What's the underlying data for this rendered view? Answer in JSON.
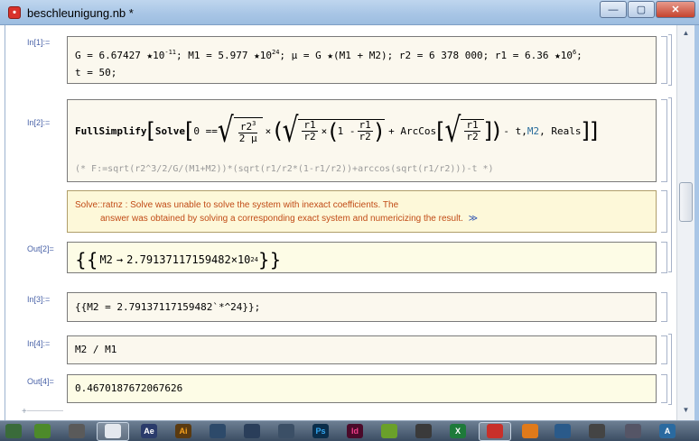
{
  "window": {
    "title": "beschleunigung.nb *",
    "min_glyph": "—",
    "max_glyph": "▢",
    "close_glyph": "✕"
  },
  "cells": {
    "in1_label": "In[1]:=",
    "in1_line1": {
      "a": "G = 6.67427 ",
      "b": "10",
      "c": "-11",
      "d": "; M1 = 5.977 ",
      "e": "10",
      "f": "24",
      "g": "; μ = G ",
      "h": "(M1 + M2); r2 = 6 378 000; r1 = 6.36 ",
      "i": "10",
      "j": "6",
      "k": ";"
    },
    "in1_line2": "t = 50;",
    "in2_label": "In[2]:=",
    "in2": {
      "fs": "FullSimplify",
      "solve": "Solve",
      "zero": "0 ==",
      "r2": "r2",
      "exp3": "3",
      "two_mu": "2 μ",
      "times": "×",
      "r1": "r1",
      "one_minus": "1 -",
      "plus_arccos": "+ ArcCos",
      "rest_a": "- t, ",
      "m2": "M2",
      "rest_b": ", Reals"
    },
    "in2_comment": "(* F:=sqrt(r2^3/2/G/(M1+M2))*(sqrt(r1/r2*(1-r1/r2))+arccos(sqrt(r1/r2)))-t *)",
    "msg_line1": "Solve::ratnz :  Solve was unable to solve the system with inexact coefficients. The",
    "msg_line2": "answer was obtained by solving a corresponding exact system and numericizing the result.",
    "msg_more": "≫",
    "out2_label": "Out[2]=",
    "out2": {
      "open": "{{",
      "m2": "M2",
      "arrow": "→",
      "val": "2.79137117159482",
      "times10": "×10",
      "exp": "24",
      "close": "}}"
    },
    "in3_label": "In[3]:=",
    "in3": "{{M2 = 2.79137117159482`*^24}};",
    "in4_label": "In[4]:=",
    "in4": "M2 / M1",
    "out4_label": "Out[4]=",
    "out4": "0.4670187672067626"
  },
  "taskbar": {
    "items": [
      "DW",
      "Fx",
      "Ae",
      "Ai",
      "Ps",
      "Id",
      "X",
      "A"
    ]
  },
  "colors": {
    "label_blue": "#4a63a8",
    "message_orange": "#c14b16",
    "input_bg": "#fbf8ee",
    "output_bg": "#fdfce6",
    "symbol_blue": "#2a6d9c"
  }
}
